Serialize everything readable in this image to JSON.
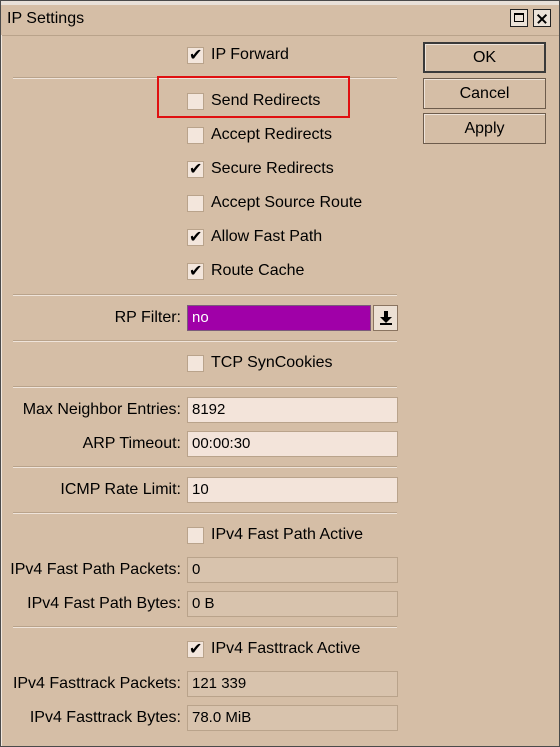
{
  "window": {
    "title": "IP Settings"
  },
  "buttons": {
    "ok": "OK",
    "cancel": "Cancel",
    "apply": "Apply"
  },
  "checkboxes": {
    "ip_forward": {
      "label": "IP Forward",
      "checked": true
    },
    "send_redirects": {
      "label": "Send Redirects",
      "checked": false
    },
    "accept_redirects": {
      "label": "Accept Redirects",
      "checked": false
    },
    "secure_redirects": {
      "label": "Secure Redirects",
      "checked": true
    },
    "accept_source_route": {
      "label": "Accept Source Route",
      "checked": false
    },
    "allow_fast_path": {
      "label": "Allow Fast Path",
      "checked": true
    },
    "route_cache": {
      "label": "Route Cache",
      "checked": true
    },
    "tcp_syncookies": {
      "label": "TCP SynCookies",
      "checked": false
    },
    "ipv4_fast_path_active": {
      "label": "IPv4 Fast Path Active",
      "checked": false
    },
    "ipv4_fasttrack_active": {
      "label": "IPv4 Fasttrack Active",
      "checked": true
    }
  },
  "fields": {
    "rp_filter": {
      "label": "RP Filter:",
      "value": "no"
    },
    "max_neighbor_entries": {
      "label": "Max Neighbor Entries:",
      "value": "8192"
    },
    "arp_timeout": {
      "label": "ARP Timeout:",
      "value": "00:00:30"
    },
    "icmp_rate_limit": {
      "label": "ICMP Rate Limit:",
      "value": "10"
    },
    "ipv4_fast_path_packets": {
      "label": "IPv4 Fast Path Packets:",
      "value": "0"
    },
    "ipv4_fast_path_bytes": {
      "label": "IPv4 Fast Path Bytes:",
      "value": "0 B"
    },
    "ipv4_fasttrack_packets": {
      "label": "IPv4 Fasttrack Packets:",
      "value": "121 339"
    },
    "ipv4_fasttrack_bytes": {
      "label": "IPv4 Fasttrack Bytes:",
      "value": "78.0 MiB"
    }
  },
  "colors": {
    "window_bg": "#d5bea6",
    "rp_filter_bg": "#a000a8",
    "highlight": "#e01010"
  }
}
